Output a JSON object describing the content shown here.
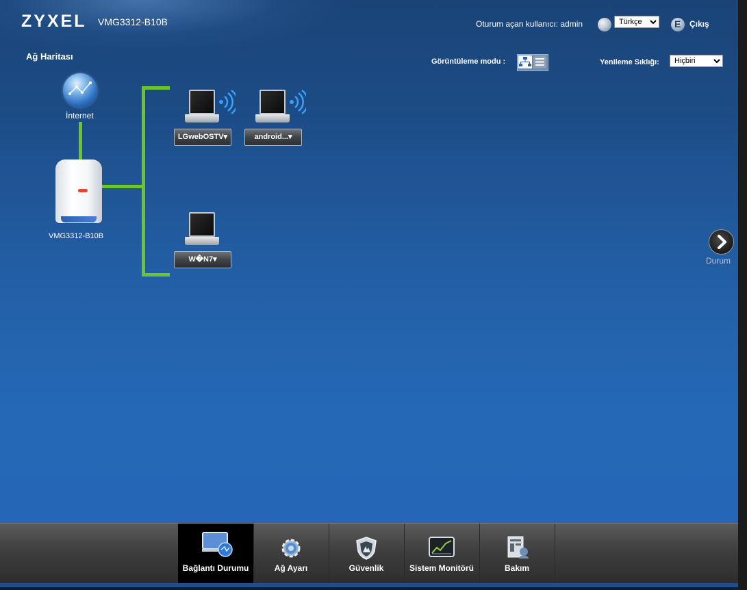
{
  "header": {
    "brand": "ZYXEL",
    "model": "VMG3312-B10B",
    "user_label": "Oturum açan kullanıcı:",
    "username": "admin",
    "user_line": "Oturum açan kullanıcı:  admin",
    "language_selected": "Türkçe",
    "logout_label": "Çıkış"
  },
  "page": {
    "title": "Ağ Haritası",
    "view_mode_label": "Görüntüleme modu :",
    "refresh_label": "Yenileme Sıklığı:",
    "refresh_selected": "Hiçbiri"
  },
  "map": {
    "internet_label": "İnternet",
    "router_label": "VMG3312-B10B",
    "devices": [
      {
        "label": "LGwebOSTV▾",
        "type": "laptop",
        "wireless": true
      },
      {
        "label": "android...▾",
        "type": "laptop",
        "wireless": true
      },
      {
        "label": "W�N7▾",
        "type": "laptop",
        "wireless": false
      }
    ]
  },
  "side": {
    "durum_label": "Durum"
  },
  "footer": {
    "tabs": [
      {
        "label": "Bağlantı Durumu",
        "icon": "network-status-icon",
        "active": true
      },
      {
        "label": "Ağ Ayarı",
        "icon": "gear-icon",
        "active": false
      },
      {
        "label": "Güvenlik",
        "icon": "shield-icon",
        "active": false
      },
      {
        "label": "Sistem Monitörü",
        "icon": "monitor-chart-icon",
        "active": false
      },
      {
        "label": "Bakım",
        "icon": "maintenance-icon",
        "active": false
      }
    ]
  },
  "colors": {
    "link_line": "#6cc726",
    "background": "#2360a8",
    "footer": "#3e3e3e"
  }
}
